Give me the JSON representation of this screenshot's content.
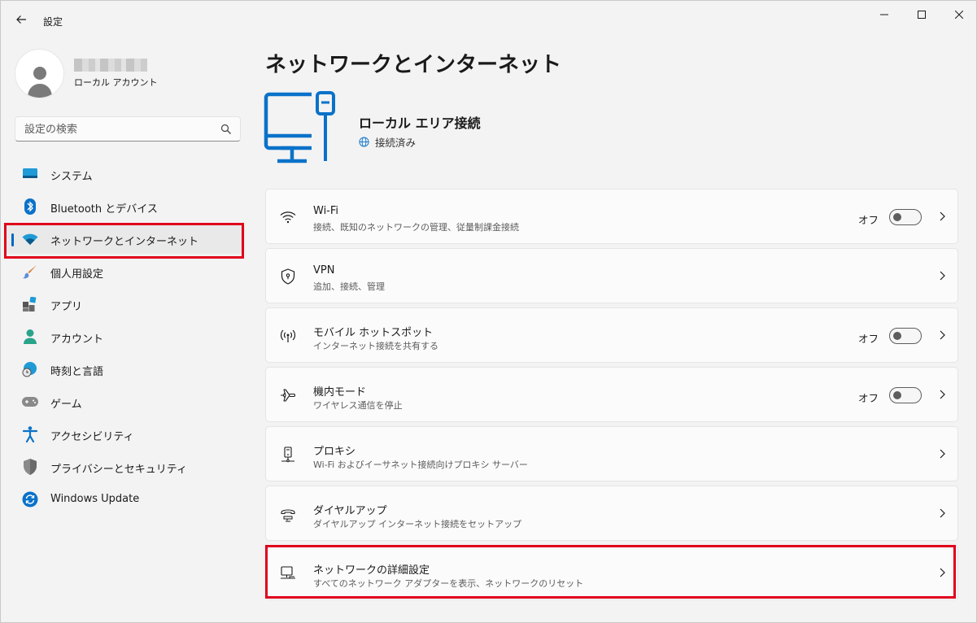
{
  "window": {
    "title": "設定"
  },
  "profile": {
    "account_type": "ローカル アカウント"
  },
  "search": {
    "placeholder": "設定の検索"
  },
  "sidebar": {
    "items": [
      {
        "label": "システム",
        "icon": "monitor-icon"
      },
      {
        "label": "Bluetooth とデバイス",
        "icon": "bluetooth-icon"
      },
      {
        "label": "ネットワークとインターネット",
        "icon": "wifi-icon",
        "selected": true
      },
      {
        "label": "個人用設定",
        "icon": "brush-icon"
      },
      {
        "label": "アプリ",
        "icon": "apps-icon"
      },
      {
        "label": "アカウント",
        "icon": "person-icon"
      },
      {
        "label": "時刻と言語",
        "icon": "globe-clock-icon"
      },
      {
        "label": "ゲーム",
        "icon": "gamepad-icon"
      },
      {
        "label": "アクセシビリティ",
        "icon": "accessibility-icon"
      },
      {
        "label": "プライバシーとセキュリティ",
        "icon": "shield-icon"
      },
      {
        "label": "Windows Update",
        "icon": "update-icon"
      }
    ]
  },
  "main": {
    "title": "ネットワークとインターネット",
    "connection": {
      "name": "ローカル エリア接続",
      "status": "接続済み"
    },
    "cards": [
      {
        "title": "Wi-Fi",
        "subtitle": "接続、既知のネットワークの管理、従量制課金接続",
        "icon": "wifi-icon",
        "toggle": "オフ"
      },
      {
        "title": "VPN",
        "subtitle": "追加、接続、管理",
        "icon": "shield-icon"
      },
      {
        "title": "モバイル ホットスポット",
        "subtitle": "インターネット接続を共有する",
        "icon": "hotspot-icon",
        "toggle": "オフ"
      },
      {
        "title": "機内モード",
        "subtitle": "ワイヤレス通信を停止",
        "icon": "airplane-icon",
        "toggle": "オフ"
      },
      {
        "title": "プロキシ",
        "subtitle": "Wi-Fi およびイーサネット接続向けプロキシ サーバー",
        "icon": "proxy-icon"
      },
      {
        "title": "ダイヤルアップ",
        "subtitle": "ダイヤルアップ インターネット接続をセットアップ",
        "icon": "dialup-icon"
      },
      {
        "title": "ネットワークの詳細設定",
        "subtitle": "すべてのネットワーク アダプターを表示、ネットワークのリセット",
        "icon": "network-pc-icon"
      }
    ]
  },
  "colors": {
    "accent": "#0067c0",
    "highlight": "#e0001b"
  }
}
